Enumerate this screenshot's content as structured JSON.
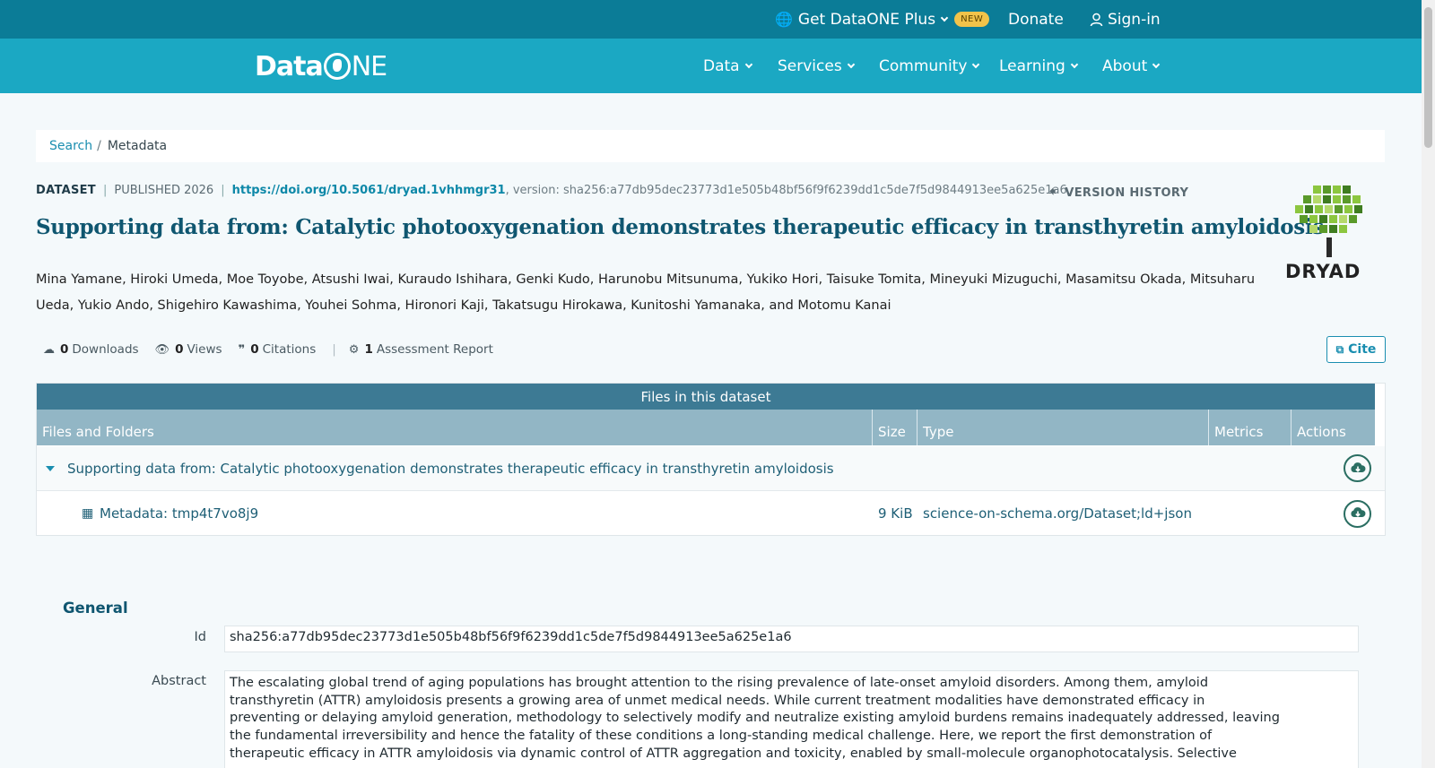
{
  "topbar": {
    "plus_label": "Get DataONE Plus",
    "new_badge": "NEW",
    "donate_label": "Donate",
    "signin_label": "Sign-in"
  },
  "nav": {
    "logo_text_a": "Data",
    "logo_text_b": "NE",
    "items": [
      "Data",
      "Services",
      "Community",
      "Learning",
      "About"
    ]
  },
  "breadcrumb": {
    "search": "Search",
    "separator": "/",
    "current": "Metadata"
  },
  "dataset": {
    "type_label": "DATASET",
    "published": "PUBLISHED 2026",
    "doi": "https://doi.org/10.5061/dryad.1vhhmgr31",
    "version_text": ", version: sha256:a77db95dec23773d1e505b48bf56f9f6239dd1c5de7f5d9844913ee5a625e1a6",
    "version_history": "VERSION HISTORY",
    "title": "Supporting data from: Catalytic photooxygenation demonstrates therapeutic efficacy in transthyretin amyloidosis",
    "authors": "Mina Yamane, Hiroki Umeda, Moe Toyobe, Atsushi Iwai, Kuraudo Ishihara, Genki Kudo, Harunobu Mitsunuma, Yukiko Hori, Taisuke Tomita, Mineyuki Mizuguchi, Masamitsu Okada, Mitsuharu Ueda, Yukio Ando, Shigehiro Kawashima, Youhei Sohma, Hironori Kaji, Takatsugu Hirokawa, Kunitoshi Yamanaka, and Motomu Kanai",
    "repository_logo": "DRYAD"
  },
  "stats": {
    "downloads_count": "0",
    "downloads_label": "Downloads",
    "views_count": "0",
    "views_label": "Views",
    "citations_count": "0",
    "citations_label": "Citations",
    "assessment_count": "1",
    "assessment_label": "Assessment Report",
    "cite_label": "Cite"
  },
  "files": {
    "heading": "Files in this dataset",
    "columns": [
      "Files and Folders",
      "Size",
      "Type",
      "Metrics",
      "Actions"
    ],
    "folder_name": "Supporting data from: Catalytic photooxygenation demonstrates therapeutic efficacy in transthyretin amyloidosis",
    "file": {
      "name": "Metadata: tmp4t7vo8j9",
      "size": "9 KiB",
      "type": "science-on-schema.org/Dataset;ld+json"
    }
  },
  "general": {
    "heading": "General",
    "id_label": "Id",
    "id_value": "sha256:a77db95dec23773d1e505b48bf56f9f6239dd1c5de7f5d9844913ee5a625e1a6",
    "abstract_label": "Abstract",
    "abstract_lines": [
      "The escalating global trend of aging populations has brought attention to the rising prevalence of late-onset amyloid disorders. Among them, amyloid",
      "transthyretin (ATTR) amyloidosis presents a growing area of unmet medical needs. While current treatment modalities have demonstrated efficacy in",
      "preventing or delaying amyloid generation, methodology to selectively modify and neutralize existing amyloid burdens remains inadequately addressed, leaving",
      "the fundamental irreversibility and hence the fatality of these conditions a long-standing medical challenge. Here, we report the first demonstration of",
      "therapeutic efficacy in ATTR amyloidosis via dynamic control of ATTR aggregation and toxicity, enabled by small-molecule organophotocatalysis. Selective"
    ]
  },
  "colors": {
    "topbar": "#0b7c97",
    "navbar": "#1ba8c3",
    "title": "#0f5670",
    "link": "#1a8eb0",
    "table_head": "#3d7a94",
    "table_cols": "#92b6c5"
  }
}
